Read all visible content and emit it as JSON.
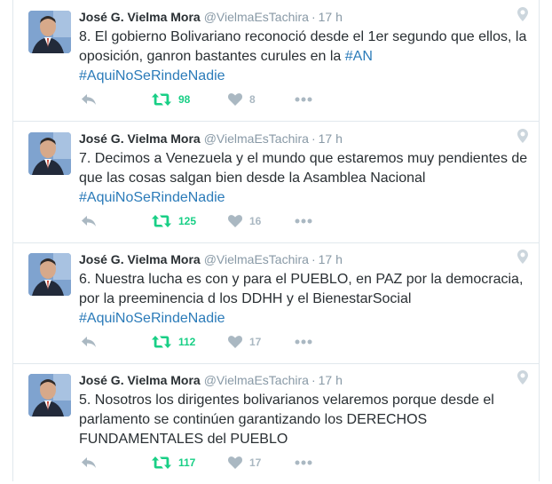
{
  "tweets": [
    {
      "fullname": "José G. Vielma Mora",
      "username": "@VielmaEsTachira",
      "separator": "·",
      "time": "17 h",
      "text_before": "8. El gobierno Bolivariano reconoció desde el 1er  segundo que ellos, la oposición, ganron bastantes curules en la ",
      "text_link": "#AN",
      "hashtag": "#AquiNoSeRindeNadie",
      "retweets": "98",
      "likes": "8"
    },
    {
      "fullname": "José G. Vielma Mora",
      "username": "@VielmaEsTachira",
      "separator": "·",
      "time": "17 h",
      "text_before": "7. Decimos a Venezuela y el mundo que estaremos muy pendientes de que las cosas salgan bien desde la Asamblea Nacional",
      "text_link": "",
      "hashtag": "#AquiNoSeRindeNadie",
      "retweets": "125",
      "likes": "16"
    },
    {
      "fullname": "José G. Vielma Mora",
      "username": "@VielmaEsTachira",
      "separator": "·",
      "time": "17 h",
      "text_before": "6. Nuestra lucha es con y para el PUEBLO, en PAZ  por la democracia, por la preeminencia d los DDHH y el BienestarSocial",
      "text_link": "",
      "hashtag": "#AquiNoSeRindeNadie",
      "retweets": "112",
      "likes": "17"
    },
    {
      "fullname": "José G. Vielma Mora",
      "username": "@VielmaEsTachira",
      "separator": "·",
      "time": "17 h",
      "text_before": "5. Nosotros los dirigentes bolivarianos velaremos porque desde el parlamento se continúen garantizando los DERECHOS FUNDAMENTALES del PUEBLO",
      "text_link": "",
      "hashtag": "",
      "retweets": "117",
      "likes": "17"
    }
  ],
  "colors": {
    "link": "#2b7bb9",
    "retweet": "#19cf86",
    "muted": "#8899a6",
    "icon": "#aab8c2",
    "border": "#e1e8ed"
  },
  "icons": {
    "reply": "reply-icon",
    "retweet": "retweet-icon",
    "like": "heart-icon",
    "more": "more-icon",
    "geo": "location-pin-icon"
  }
}
